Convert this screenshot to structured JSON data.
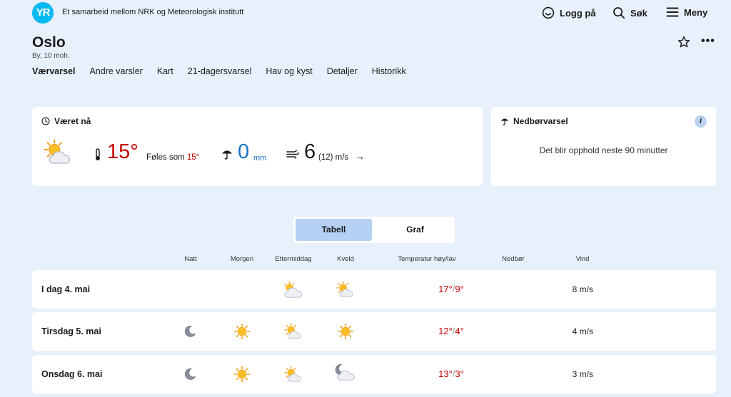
{
  "header": {
    "logo_text": "YR",
    "tagline": "Et samarbeid mellom NRK og Meteorologisk institutt",
    "login_label": "Logg på",
    "search_label": "Søk",
    "menu_label": "Meny"
  },
  "place": {
    "name": "Oslo",
    "subtitle": "By, 10 moh.",
    "more_label": "•••"
  },
  "tabs": [
    {
      "label": "Værvarsel",
      "active": true
    },
    {
      "label": "Andre varsler",
      "active": false
    },
    {
      "label": "Kart",
      "active": false
    },
    {
      "label": "21-dagersvarsel",
      "active": false
    },
    {
      "label": "Hav og kyst",
      "active": false
    },
    {
      "label": "Detaljer",
      "active": false
    },
    {
      "label": "Historikk",
      "active": false
    }
  ],
  "now": {
    "title": "Været nå",
    "icon": "partly-cloudy-icon",
    "temperature": "15°",
    "feels_like_label": "Føles som",
    "feels_like_value": "15°",
    "precipitation": "0",
    "precipitation_unit": "mm",
    "wind": "6",
    "wind_gust": "(12) m/s",
    "wind_arrow": "→"
  },
  "precip_forecast": {
    "title": "Nedbørvarsel",
    "info": "i",
    "message": "Det blir opphold neste 90 minutter"
  },
  "toggle": {
    "table_label": "Tabell",
    "graph_label": "Graf",
    "selected": "Tabell"
  },
  "table": {
    "headers": {
      "night": "Natt",
      "morning": "Morgen",
      "afternoon": "Ettermiddag",
      "evening": "Kveld",
      "temp": "Temperatur høy/lav",
      "precip": "Nedbør",
      "wind": "Vind"
    },
    "rows": [
      {
        "label": "I dag 4. mai",
        "night": "",
        "morning": "",
        "afternoon": "cloud-sun-icon",
        "evening": "partly-cloudy-icon",
        "high": "17°",
        "low": "9°",
        "wind": "8 m/s"
      },
      {
        "label": "Tirsdag 5. mai",
        "night": "moon-icon",
        "morning": "sun-icon",
        "afternoon": "partly-cloudy-icon",
        "evening": "sun-icon",
        "high": "12°",
        "low": "4°",
        "wind": "4 m/s"
      },
      {
        "label": "Onsdag 6. mai",
        "night": "moon-icon",
        "morning": "sun-icon",
        "afternoon": "partly-cloudy-icon",
        "evening": "cloud-moon-icon",
        "high": "13°",
        "low": "3°",
        "wind": "3 m/s"
      }
    ]
  },
  "colors": {
    "background": "#e8f0fb",
    "warm_temp": "#c60000",
    "rain": "#1e72c9",
    "accent": "#00b9f1",
    "toggle_selected": "#b4d1f3"
  }
}
